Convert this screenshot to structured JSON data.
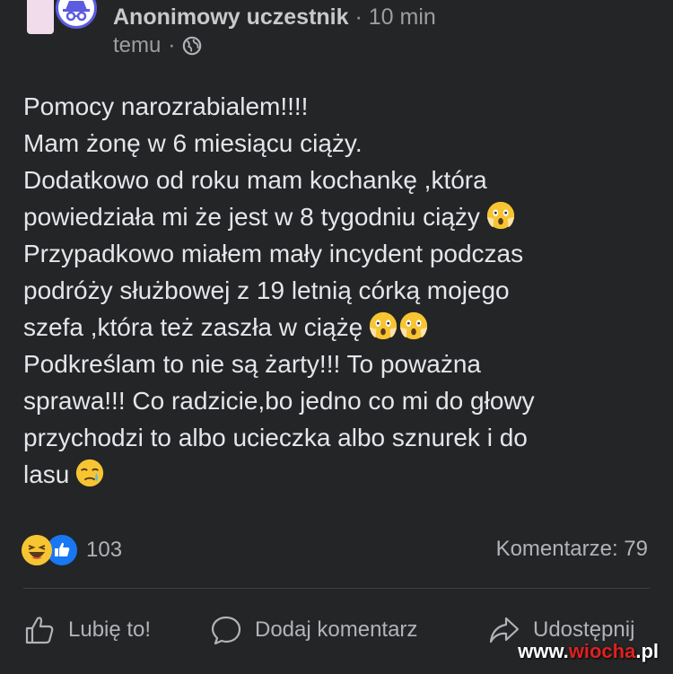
{
  "post": {
    "author": "Anonimowy uczestnik",
    "separator": "·",
    "time_part1": "10 min",
    "time_part2": "temu",
    "time_separator": "·",
    "visibility_icon": "globe-icon",
    "text_lines": [
      "Pomocy narozrabialem!!!!",
      "Mam żonę w 6 miesiącu ciąży.",
      "Dodatkowo od roku mam kochankę ,która",
      "powiedziała mi że jest w 8 tygodniu ciąży",
      "Przypadkowo miałem mały incydent podczas",
      "podróży służbowej z 19 letnią córką mojego",
      "szefa ,która też zaszła w ciążę",
      "Podkreślam to nie są żarty!!! To poważna",
      "sprawa!!! Co radzicie,bo jedno co mi do głowy",
      "przychodzi to albo ucieczka albo sznurek i do",
      "lasu"
    ],
    "emojis": {
      "line4": "screaming-face-emoji",
      "line7": [
        "screaming-face-emoji",
        "screaming-face-emoji"
      ],
      "line11": "crying-face-emoji"
    }
  },
  "stats": {
    "reaction_icons": [
      "haha-reaction-icon",
      "like-reaction-icon"
    ],
    "reaction_count": "103",
    "comments_label": "Komentarze: 79"
  },
  "actions": {
    "like_label": "Lubię to!",
    "comment_label": "Dodaj komentarz",
    "share_label": "Udostępnij"
  },
  "watermark": {
    "prefix": "www.",
    "brand": "wiocha",
    "suffix": ".pl"
  },
  "colors": {
    "background": "#242526",
    "text": "#e4e6eb",
    "muted": "#b0b3b8",
    "like_blue": "#1877f2",
    "haha_yellow": "#f7c531",
    "watermark_red": "#e02020"
  }
}
